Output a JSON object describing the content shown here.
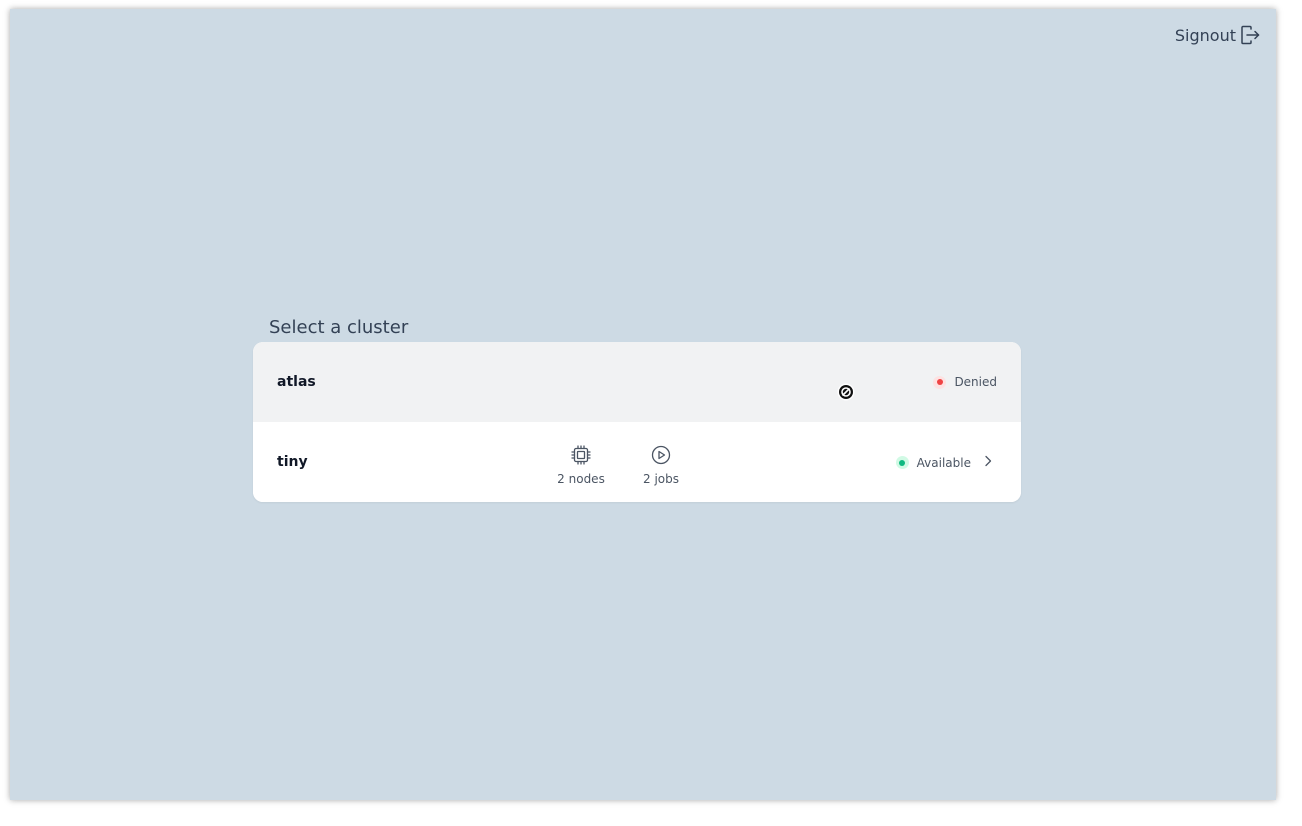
{
  "header": {
    "signout_label": "Signout"
  },
  "main": {
    "title": "Select a cluster",
    "clusters": [
      {
        "name": "atlas",
        "status": "Denied",
        "status_color": "#ef4444"
      },
      {
        "name": "tiny",
        "nodes_label": "2 nodes",
        "jobs_label": "2 jobs",
        "status": "Available",
        "status_color": "#10b981"
      }
    ]
  },
  "icons": {
    "signout": "signout-icon",
    "nodes": "cpu-chip-icon",
    "jobs": "play-circle-icon",
    "arrow": "chevron-right-icon",
    "cursor": "not-allowed-cursor-icon"
  },
  "colors": {
    "background": "#cddae4",
    "card": "#ffffff",
    "denied_row": "#f1f2f3",
    "text": "#334155"
  }
}
